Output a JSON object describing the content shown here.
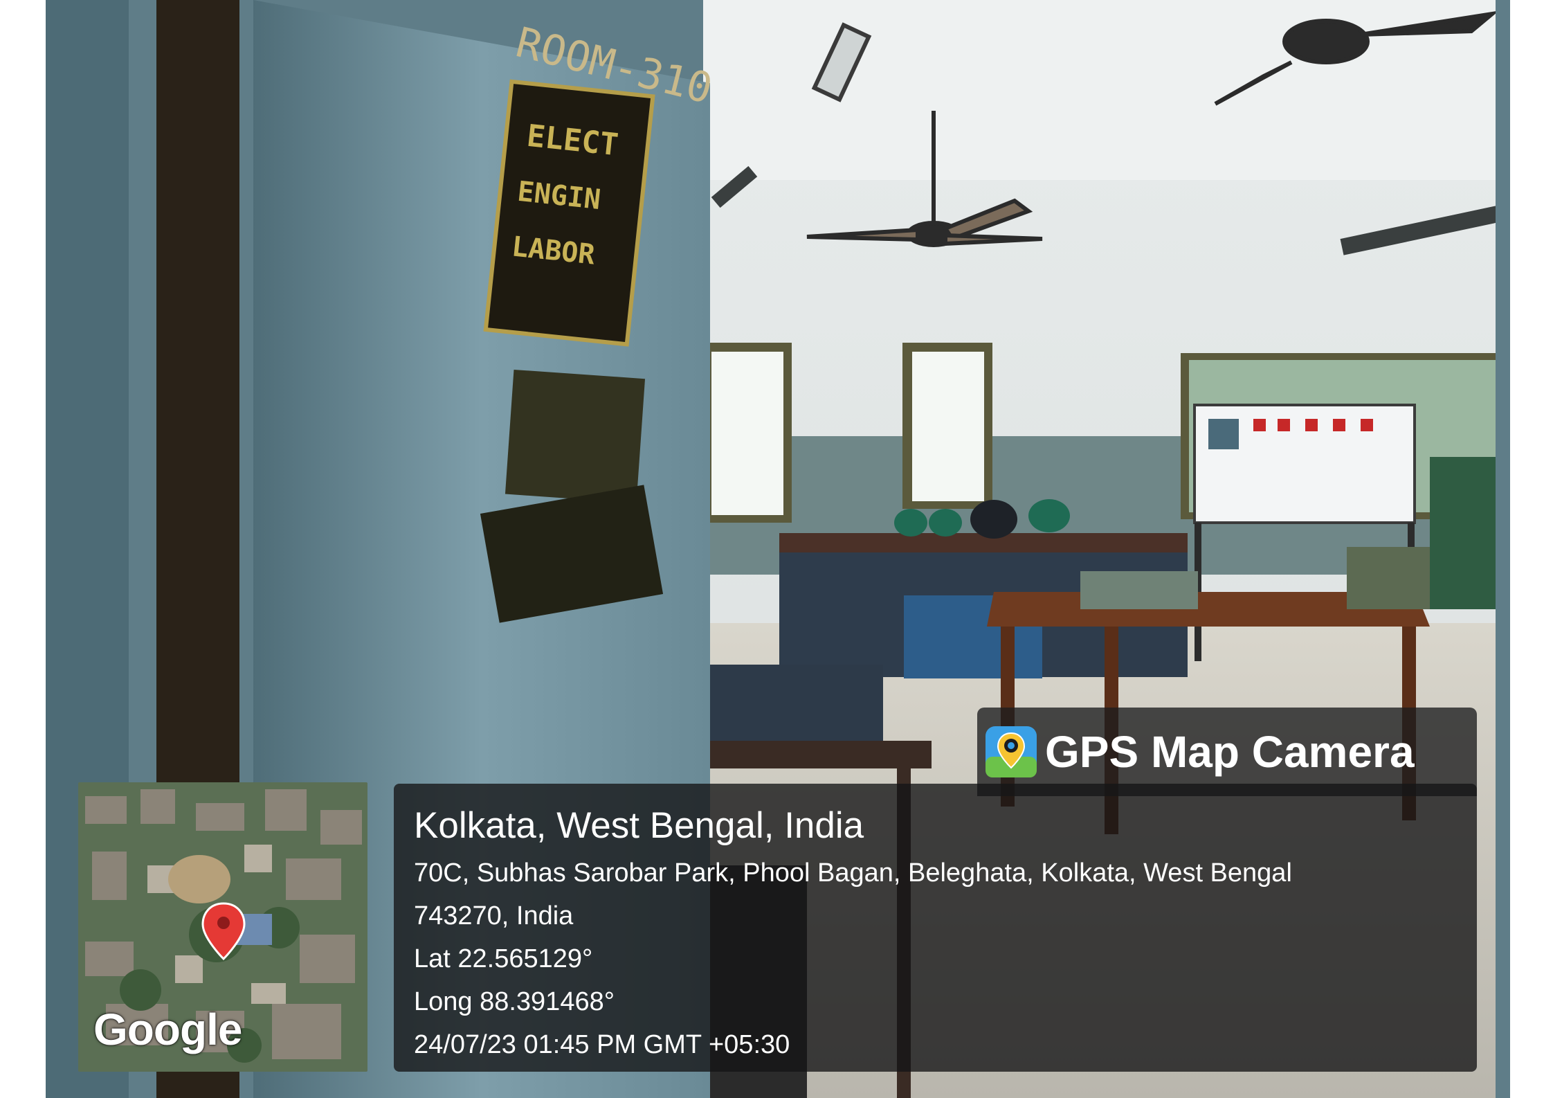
{
  "photo": {
    "sign_room": "ROOM-310",
    "sign_lab": [
      "ELECTRICAL",
      "ENGINEERING",
      "LABORATORY"
    ]
  },
  "overlay": {
    "app_name": "GPS Map Camera",
    "app_icon": "gps-map-camera-icon",
    "map_brand": "Google",
    "location_title": "Kolkata, West Bengal, India",
    "address_line1": "70C, Subhas Sarobar Park, Phool Bagan, Beleghata, Kolkata, West Bengal",
    "address_line2": "743270, India",
    "latitude": "Lat 22.565129°",
    "longitude": "Long 88.391468°",
    "datetime": "24/07/23 01:45 PM GMT +05:30"
  },
  "colors": {
    "overlay_bg": "#1c1c1e",
    "pin": "#e53935",
    "door": "#7a9aa6"
  }
}
